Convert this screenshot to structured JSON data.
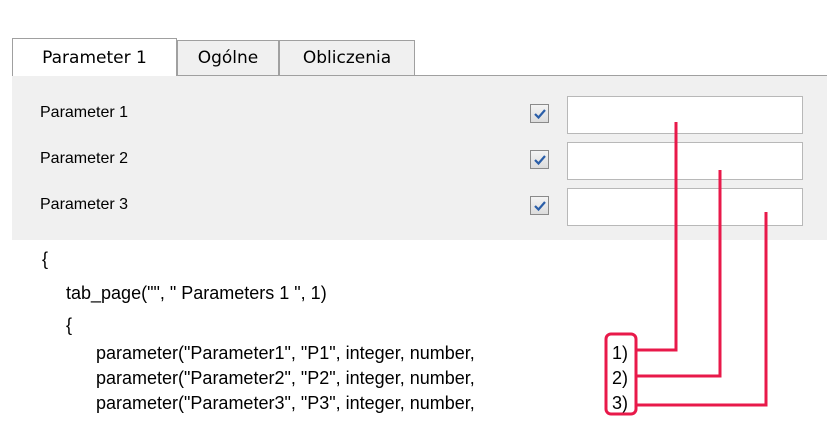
{
  "tabs": [
    {
      "label": "Parameter 1"
    },
    {
      "label": "Ogólne"
    },
    {
      "label": "Obliczenia"
    }
  ],
  "form": {
    "rows": [
      {
        "label": "Parameter 1",
        "checked": true,
        "value": ""
      },
      {
        "label": "Parameter 2",
        "checked": true,
        "value": ""
      },
      {
        "label": "Parameter 3",
        "checked": true,
        "value": ""
      }
    ]
  },
  "code": {
    "line1": "{",
    "line2": "tab_page(\"\", \" Parameters 1 \", 1)",
    "line3": "{",
    "line4": "parameter(\"Parameter1\", \"P1\", integer, number,",
    "line4_idx": "1)",
    "line5": "parameter(\"Parameter2\", \"P2\", integer, number,",
    "line5_idx": "2)",
    "line6": "parameter(\"Parameter3\", \"P3\", integer, number,",
    "line6_idx": "3)"
  },
  "colors": {
    "annotation": "#e8194a",
    "checkmark": "#2a5ea8",
    "panel": "#f0f0f0"
  }
}
